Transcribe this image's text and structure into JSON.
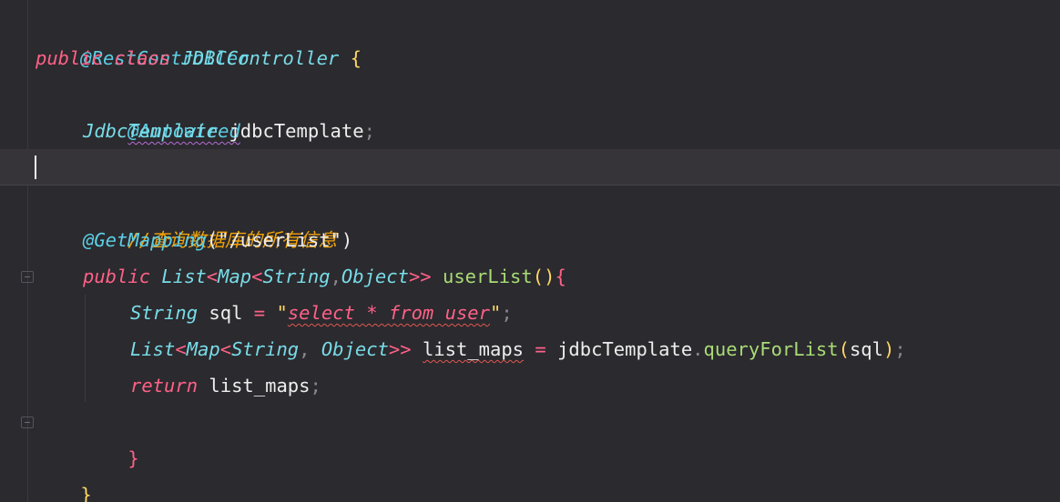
{
  "code": {
    "l1": {
      "annotation": "@RestController"
    },
    "l2": {
      "kw_public": "public",
      "kw_class": "class",
      "class_name": "JDBCController",
      "brace": "{"
    },
    "l3": {
      "annotation": "@Autowired"
    },
    "l4": {
      "type": "JdbcTemplate",
      "field": "jdbcTemplate",
      "semi": ";"
    },
    "l6": {
      "comment": "//查询数据库的所有信息"
    },
    "l7": {
      "annotation": "@GetMapping",
      "open": "(",
      "path": "\"/userList\"",
      "close": ")"
    },
    "l8": {
      "kw_public": "public",
      "t_list": "List",
      "lt1": "<",
      "t_map": "Map",
      "lt2": "<",
      "t_string": "String",
      "comma": ",",
      "t_object": "Object",
      "gt": ">>",
      "method": "userList",
      "parens": "()",
      "brace": "{"
    },
    "l9": {
      "type": "String",
      "var": "sql",
      "eq": "=",
      "quote_open": "\"",
      "sql_text": "select * from user",
      "quote_close": "\"",
      "semi": ";"
    },
    "l10": {
      "t_list": "List",
      "lt1": "<",
      "t_map": "Map",
      "lt2": "<",
      "t_string": "String",
      "comma": ",",
      "t_object": "Object",
      "gt": ">>",
      "var": "list_maps",
      "eq": "=",
      "obj": "jdbcTemplate",
      "dot": ".",
      "method": "queryForList",
      "open": "(",
      "arg": "sql",
      "close": ")",
      "semi": ";"
    },
    "l11": {
      "kw_return": "return",
      "var": "list_maps",
      "semi": ";"
    },
    "l12": {
      "brace": "}"
    },
    "l13": {
      "brace": "}"
    }
  },
  "colors": {
    "background": "#2b2a2e",
    "keyword": "#ff6188",
    "type": "#78dce8",
    "annotation": "#5ccfe6",
    "brace": "#ffd866",
    "comment": "#f0a30a",
    "method": "#a9dc76"
  },
  "icons": {
    "fold_open": "fold-open-icon",
    "fold_close": "fold-close-icon",
    "caret": "text-caret"
  }
}
